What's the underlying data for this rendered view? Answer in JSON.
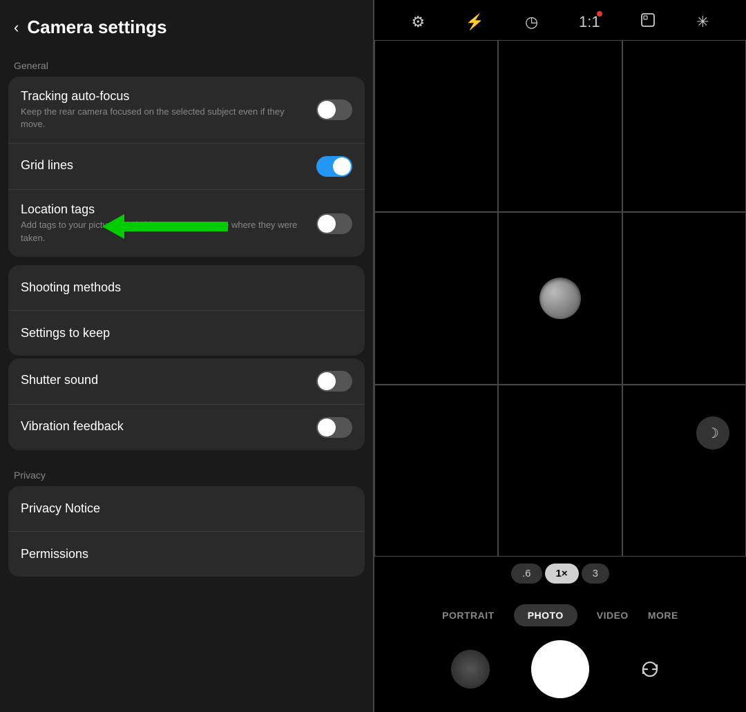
{
  "header": {
    "back_label": "‹",
    "title": "Camera settings"
  },
  "general_section": {
    "label": "General",
    "tracking_autofocus": {
      "title": "Tracking auto-focus",
      "desc": "Keep the rear camera focused on the selected subject even if they move.",
      "state": "off"
    },
    "grid_lines": {
      "title": "Grid lines",
      "state": "on"
    },
    "location_tags": {
      "title": "Location tags",
      "desc": "Add tags to your pictures and videos so you can see where they were taken.",
      "state": "off"
    }
  },
  "nav_items": [
    {
      "id": "shooting-methods",
      "label": "Shooting methods"
    },
    {
      "id": "settings-to-keep",
      "label": "Settings to keep"
    }
  ],
  "shutter_sound": {
    "title": "Shutter sound",
    "state": "off"
  },
  "vibration_feedback": {
    "title": "Vibration feedback",
    "state": "off"
  },
  "privacy_section": {
    "label": "Privacy",
    "items": [
      {
        "id": "privacy-notice",
        "label": "Privacy Notice"
      },
      {
        "id": "permissions",
        "label": "Permissions"
      }
    ]
  },
  "camera": {
    "icons": [
      "⚙",
      "⚡",
      "◷",
      "1:1",
      "▢",
      "✳"
    ],
    "ratio_has_dot": true,
    "zoom_options": [
      ".6",
      "1×",
      "3"
    ],
    "active_zoom": "1×",
    "mode_tabs": [
      "PORTRAIT",
      "PHOTO",
      "VIDEO",
      "MORE"
    ],
    "active_mode": "PHOTO",
    "night_mode_icon": "☽"
  }
}
